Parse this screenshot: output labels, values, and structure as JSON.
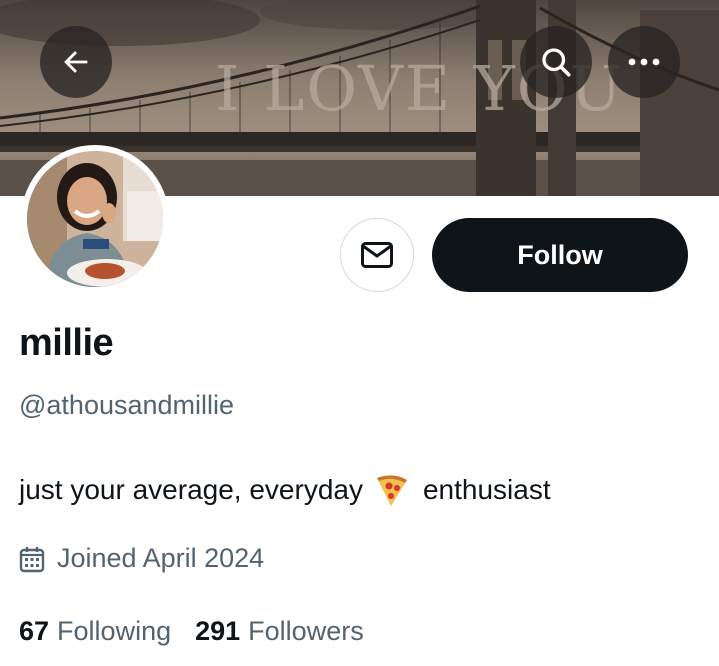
{
  "profile": {
    "display_name": "millie",
    "handle": "@athousandmillie",
    "bio_before": "just your average, everyday",
    "bio_emoji": "pizza-emoji",
    "bio_after": "enthusiast",
    "joined": "Joined April 2024"
  },
  "banner": {
    "skywriting": "I LOVE YOU"
  },
  "stats": {
    "following_count": "67",
    "following_label": "Following",
    "followers_count": "291",
    "followers_label": "Followers"
  },
  "actions": {
    "follow_label": "Follow",
    "back_icon": "arrow-left-icon",
    "search_icon": "search-icon",
    "more_icon": "more-icon",
    "message_icon": "mail-icon"
  },
  "colors": {
    "text_primary": "#0f1419",
    "text_secondary": "#536471",
    "follow_bg": "#0f1419",
    "border": "#cfd9de"
  }
}
